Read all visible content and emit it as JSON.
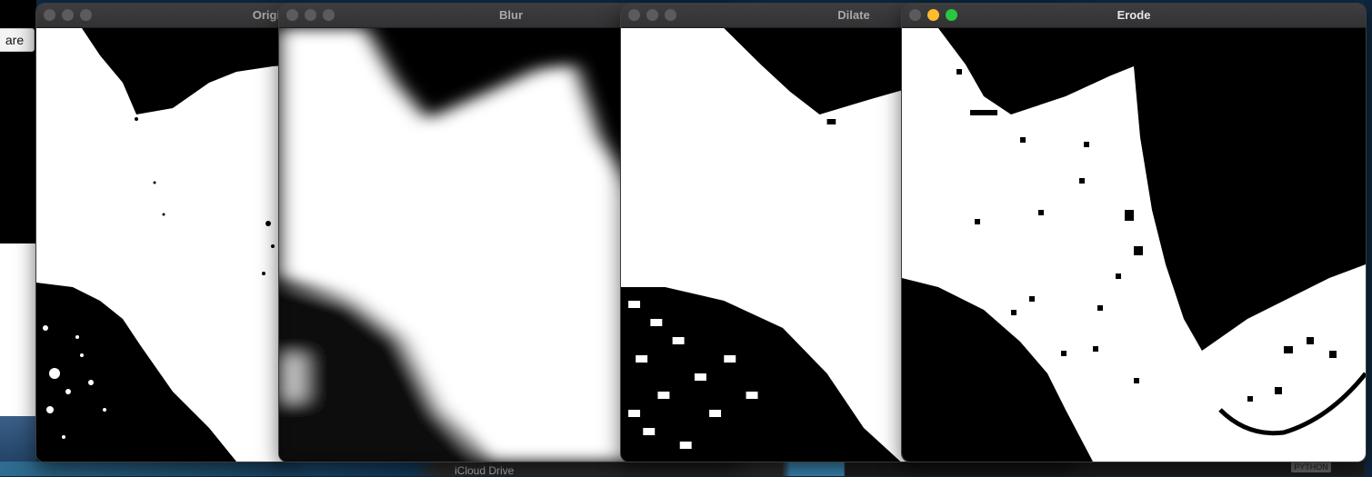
{
  "background": {
    "share_button_label": "are",
    "finder_sidebar_item": "iCloud Drive",
    "right_tag": "PYTHON"
  },
  "windows": [
    {
      "title": "Origin",
      "image_icon": "binary-mask-image"
    },
    {
      "title": "Blur",
      "image_icon": "blurred-mask-image"
    },
    {
      "title": "Dilate",
      "image_icon": "dilated-mask-image"
    },
    {
      "title": "Erode",
      "image_icon": "eroded-mask-image"
    }
  ],
  "colors": {
    "traffic_inactive": "#5b5b5d",
    "traffic_minimize": "#febc2e",
    "traffic_zoom": "#28c840"
  }
}
